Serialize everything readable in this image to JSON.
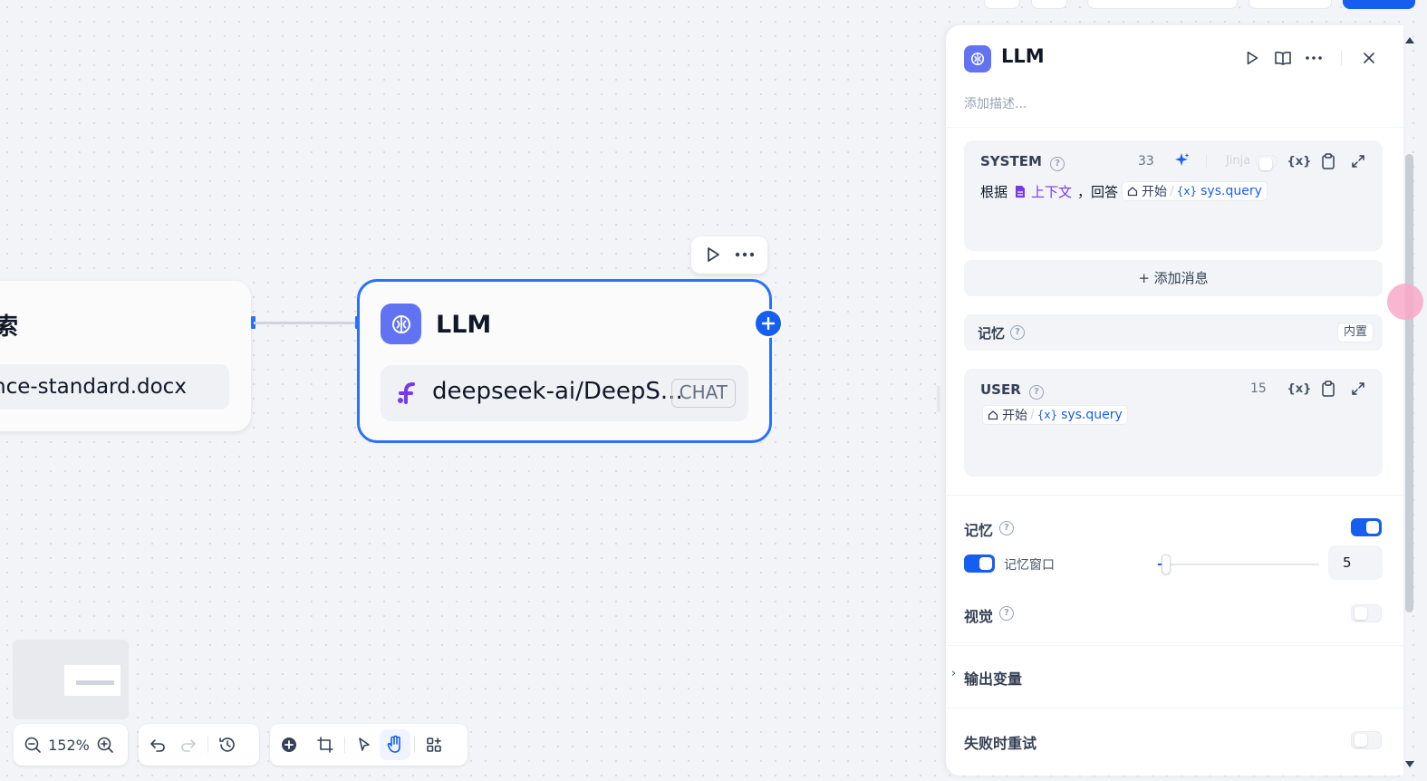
{
  "canvas": {
    "prev_node": {
      "title_fragment": "索",
      "document": "nce-standard.docx"
    },
    "llm_node": {
      "title": "LLM",
      "model_name": "deepseek-ai/DeepS...",
      "model_badge": "CHAT"
    },
    "zoom": "152%"
  },
  "panel": {
    "title": "LLM",
    "description_placeholder": "添加描述...",
    "system": {
      "role": "SYSTEM",
      "count": "33",
      "jinja_label": "Jinja",
      "prompt_prefix": "根据",
      "context_var": "上下文",
      "prompt_mid": "，回答",
      "var_node": "开始",
      "var_path": "sys.query"
    },
    "add_message": "+ 添加消息",
    "memory_row": {
      "label": "记忆",
      "badge": "内置"
    },
    "user": {
      "role": "USER",
      "count": "15",
      "var_node": "开始",
      "var_path": "sys.query"
    },
    "memory": {
      "label": "记忆",
      "enabled": true,
      "window_label": "记忆窗口",
      "window_enabled": true,
      "window_value": "5",
      "window_fraction": 0.05
    },
    "vision": {
      "label": "视觉",
      "enabled": false
    },
    "output_vars": "输出变量",
    "retry": {
      "label": "失败时重试",
      "enabled": false
    }
  },
  "colors": {
    "accent": "#155eef",
    "node_icon": "#6172f3",
    "context_purple": "#7839ee"
  }
}
